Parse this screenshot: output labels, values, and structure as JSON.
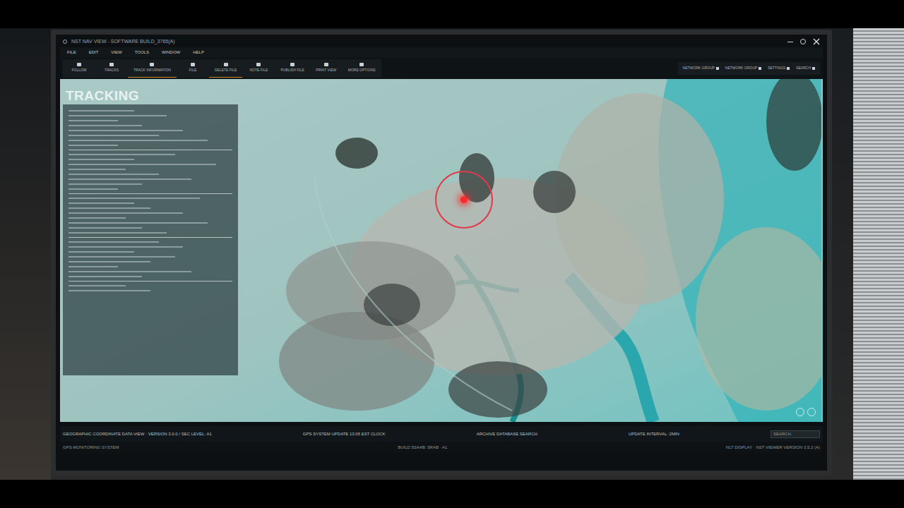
{
  "window": {
    "title": "NST NAV VIEW - SOFTWARE BUILD_3765(A)"
  },
  "menu": [
    "FILE",
    "EDIT",
    "VIEW",
    "TOOLS",
    "WINDOW",
    "HELP"
  ],
  "toolbar": [
    {
      "label": "FOLLOW",
      "selected": false
    },
    {
      "label": "TRACKS",
      "selected": false
    },
    {
      "label": "TRACK INFORMATION",
      "selected": true
    },
    {
      "label": "FILE",
      "selected": false
    },
    {
      "label": "DELETE FILE",
      "selected": true
    },
    {
      "label": "NOTE FILE",
      "selected": false
    },
    {
      "label": "PUBLISH FILE",
      "selected": false
    },
    {
      "label": "PRINT VIEW",
      "selected": false
    },
    {
      "label": "MORE OPTIONS",
      "selected": false
    }
  ],
  "right_buttons": [
    "NETWORK GROUP",
    "NETWORK GROUP",
    "SETTINGS",
    "SEARCH"
  ],
  "map": {
    "title": "TRACKING"
  },
  "status_bar": {
    "row1": [
      "GEOGRAPHIC COORDINATE DATA VIEW · VERSION 3.0.0 / SEC LEVEL: A1",
      "GPS SYSTEM UPDATE 13:05 EST CLOCK",
      "ARCHIVE DATABASE SEARCH",
      "UPDATE INTERVAL: 2MIN"
    ],
    "search_placeholder": "SEARCH",
    "row2": [
      "GPS MONITORING SYSTEM",
      "BUILD 5SAAB: 5RAB · A1",
      "NLT DISPLAY · NST VIEWER VERSION 3.5.2 (A)"
    ]
  }
}
